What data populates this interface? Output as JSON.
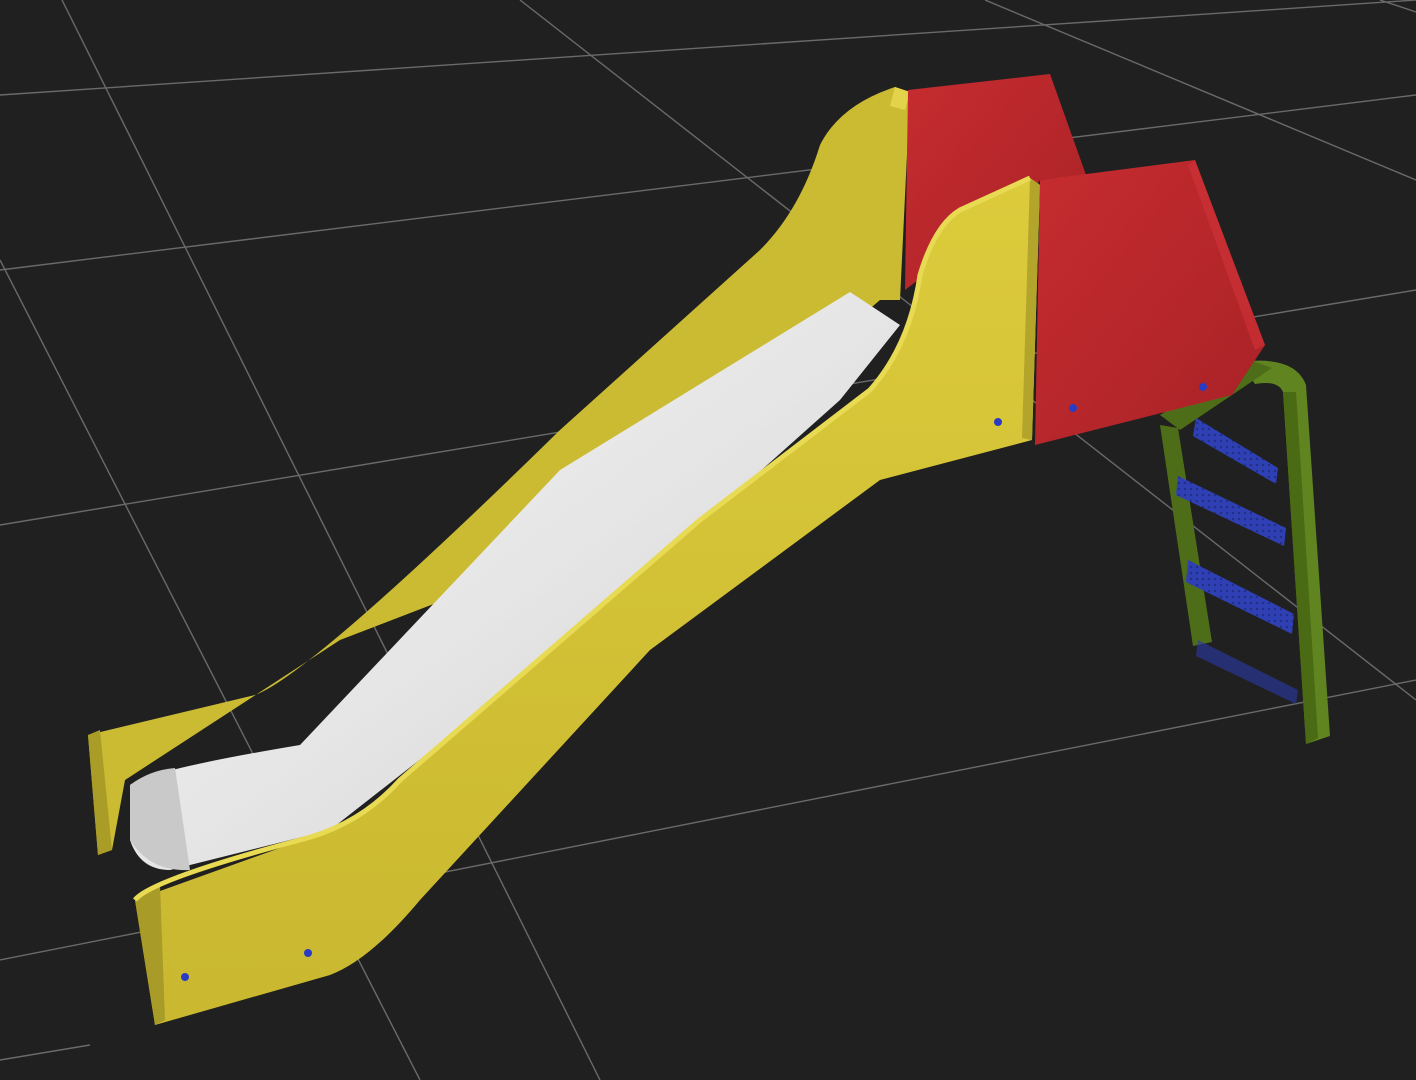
{
  "scene": {
    "background_color": "#202020",
    "grid_color": "#6a6a6a",
    "object": "playground-slide",
    "colors": {
      "side_panel": "#d2c236",
      "side_panel_shadow": "#a99d2a",
      "side_panel_edge": "#e6d74c",
      "slide_surface": "#e9e9e9",
      "slide_surface_shadow": "#bcbcbc",
      "guard_panel": "#b8262a",
      "guard_panel_shadow": "#8a1b1f",
      "ladder_frame": "#5a7d1e",
      "ladder_frame_dark": "#3e5a12",
      "ladder_rung": "#2e3fb0",
      "bolt": "#2b3cc4"
    }
  }
}
